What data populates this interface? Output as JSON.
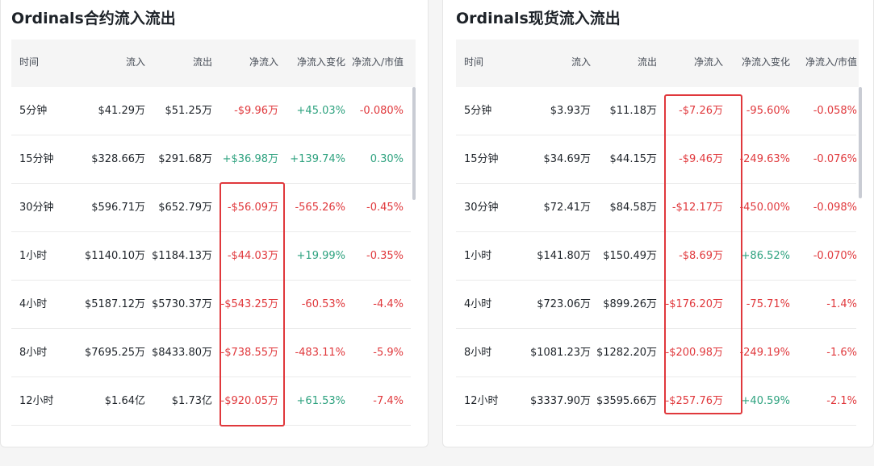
{
  "colors": {
    "negative": "#e0383c",
    "positive": "#2ea27f",
    "highlight": "#e0383c"
  },
  "left": {
    "title": "Ordinals合约流入流出",
    "headers": [
      "时间",
      "流入",
      "流出",
      "净流入",
      "净流入变化",
      "净流入/市值"
    ],
    "rows": [
      [
        "5分钟",
        "$41.29万",
        "$51.25万",
        "-$9.96万",
        "+45.03%",
        "-0.080%"
      ],
      [
        "15分钟",
        "$328.66万",
        "$291.68万",
        "+$36.98万",
        "+139.74%",
        "0.30%"
      ],
      [
        "30分钟",
        "$596.71万",
        "$652.79万",
        "-$56.09万",
        "-565.26%",
        "-0.45%"
      ],
      [
        "1小时",
        "$1140.10万",
        "$1184.13万",
        "-$44.03万",
        "+19.99%",
        "-0.35%"
      ],
      [
        "4小时",
        "$5187.12万",
        "$5730.37万",
        "-$543.25万",
        "-60.53%",
        "-4.4%"
      ],
      [
        "8小时",
        "$7695.25万",
        "$8433.80万",
        "-$738.55万",
        "-483.11%",
        "-5.9%"
      ],
      [
        "12小时",
        "$1.64亿",
        "$1.73亿",
        "-$920.05万",
        "+61.53%",
        "-7.4%"
      ]
    ]
  },
  "right": {
    "title": "Ordinals现货流入流出",
    "headers": [
      "时间",
      "流入",
      "流出",
      "净流入",
      "净流入变化",
      "净流入/市值"
    ],
    "rows": [
      [
        "5分钟",
        "$3.93万",
        "$11.18万",
        "-$7.26万",
        "-95.60%",
        "-0.058%"
      ],
      [
        "15分钟",
        "$34.69万",
        "$44.15万",
        "-$9.46万",
        "-249.63%",
        "-0.076%"
      ],
      [
        "30分钟",
        "$72.41万",
        "$84.58万",
        "-$12.17万",
        "-450.00%",
        "-0.098%"
      ],
      [
        "1小时",
        "$141.80万",
        "$150.49万",
        "-$8.69万",
        "+86.52%",
        "-0.070%"
      ],
      [
        "4小时",
        "$723.06万",
        "$899.26万",
        "-$176.20万",
        "-75.71%",
        "-1.4%"
      ],
      [
        "8小时",
        "$1081.23万",
        "$1282.20万",
        "-$200.98万",
        "-249.19%",
        "-1.6%"
      ],
      [
        "12小时",
        "$3337.90万",
        "$3595.66万",
        "-$257.76万",
        "+40.59%",
        "-2.1%"
      ]
    ]
  }
}
